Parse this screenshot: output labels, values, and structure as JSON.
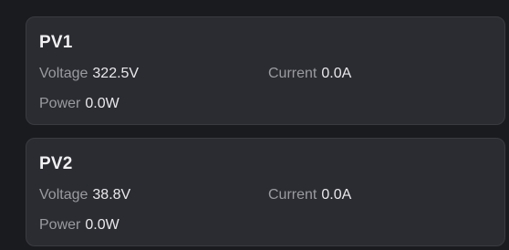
{
  "pv_panels": [
    {
      "title": "PV1",
      "voltage_label": "Voltage",
      "voltage_value": "322.5V",
      "current_label": "Current",
      "current_value": "0.0A",
      "power_label": "Power",
      "power_value": "0.0W"
    },
    {
      "title": "PV2",
      "voltage_label": "Voltage",
      "voltage_value": "38.8V",
      "current_label": "Current",
      "current_value": "0.0A",
      "power_label": "Power",
      "power_value": "0.0W"
    }
  ],
  "colors": {
    "background": "#1a1b1f",
    "card": "#2b2c31",
    "label": "#9a9ba1",
    "value": "#e9e9ec"
  }
}
